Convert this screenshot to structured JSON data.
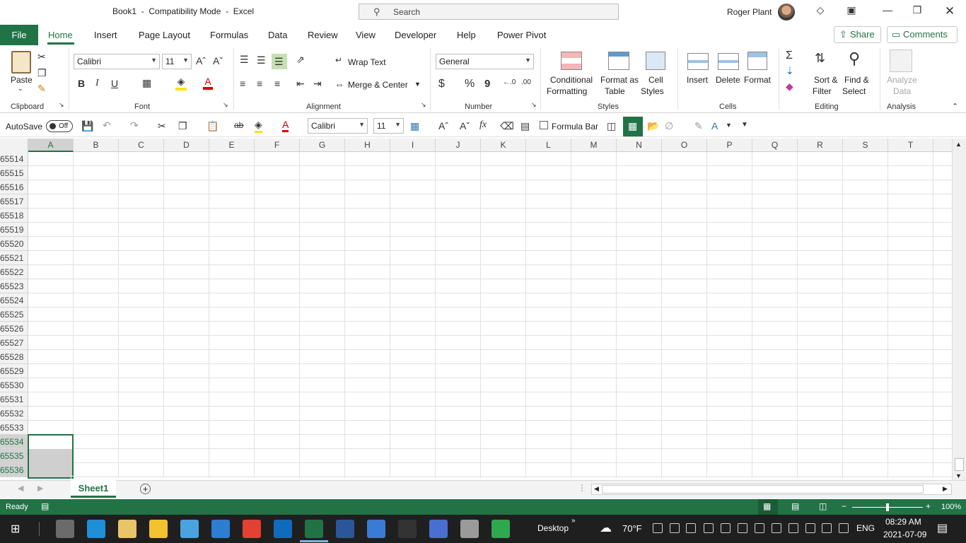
{
  "window": {
    "title": "Book1  -  Compatibility Mode  -  Excel",
    "search_placeholder": "Search",
    "user": "Roger Plant"
  },
  "tabs": {
    "file": "File",
    "items": [
      "Home",
      "Insert",
      "Page Layout",
      "Formulas",
      "Data",
      "Review",
      "View",
      "Developer",
      "Help",
      "Power Pivot"
    ],
    "share": "Share",
    "comments": "Comments"
  },
  "ribbon": {
    "clipboard": {
      "label": "Clipboard",
      "paste": "Paste"
    },
    "font": {
      "label": "Font",
      "name": "Calibri",
      "size": "11",
      "bold": "B",
      "italic": "I",
      "underline": "U"
    },
    "alignment": {
      "label": "Alignment",
      "wrap": "Wrap Text",
      "merge": "Merge & Center"
    },
    "number": {
      "label": "Number",
      "format": "General",
      "currency": "$",
      "percent": "%",
      "comma": "9"
    },
    "styles": {
      "label": "Styles",
      "conditional": [
        "Conditional",
        "Formatting"
      ],
      "table": [
        "Format as",
        "Table"
      ],
      "cell": [
        "Cell",
        "Styles"
      ]
    },
    "cells": {
      "label": "Cells",
      "insert": "Insert",
      "delete": "Delete",
      "format": "Format"
    },
    "editing": {
      "label": "Editing",
      "sort": [
        "Sort &",
        "Filter"
      ],
      "find": [
        "Find &",
        "Select"
      ]
    },
    "analysis": {
      "label": "Analysis",
      "analyze": [
        "Analyze",
        "Data"
      ]
    }
  },
  "qat": {
    "autosave": "AutoSave",
    "autosave_state": "Off",
    "font": "Calibri",
    "size": "11",
    "formula_bar": "Formula Bar"
  },
  "grid": {
    "columns": [
      "A",
      "B",
      "C",
      "D",
      "E",
      "F",
      "G",
      "H",
      "I",
      "J",
      "K",
      "L",
      "M",
      "N",
      "O",
      "P",
      "Q",
      "R",
      "S",
      "T"
    ],
    "selected_column": "A",
    "rows": [
      "65514",
      "65515",
      "65516",
      "65517",
      "65518",
      "65519",
      "65520",
      "65521",
      "65522",
      "65523",
      "65524",
      "65525",
      "65526",
      "65527",
      "65528",
      "65529",
      "65530",
      "65531",
      "65532",
      "65533",
      "65534",
      "65535",
      "65536"
    ],
    "selected_rows": [
      "65534",
      "65535",
      "65536"
    ]
  },
  "sheets": [
    "Sheet1"
  ],
  "status": {
    "ready": "Ready",
    "zoom": "100%"
  },
  "taskbar": {
    "desktop": "Desktop",
    "weather": "70°F",
    "lang": "ENG",
    "time": "08:29 AM",
    "date": "2021-07-09"
  },
  "colors": {
    "accent": "#217346",
    "taskbar": "#1f1f1f"
  }
}
